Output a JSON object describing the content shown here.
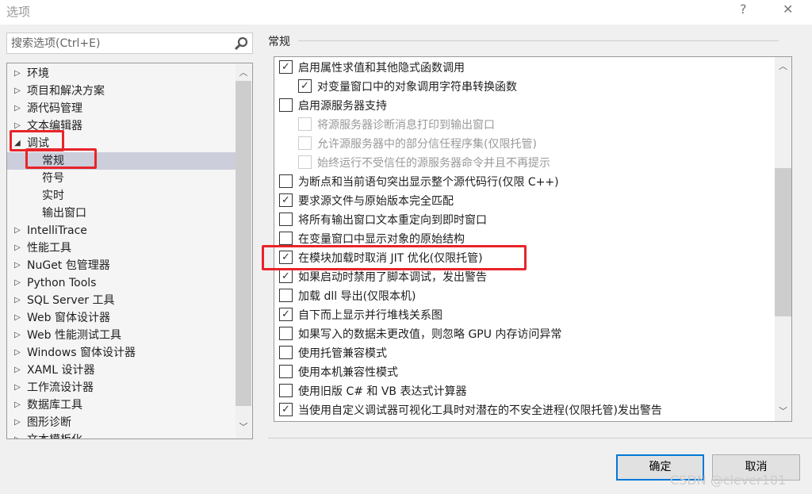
{
  "window": {
    "title": "选项",
    "help": "?",
    "close": "✕"
  },
  "search": {
    "placeholder": "搜索选项(Ctrl+E)"
  },
  "tree": {
    "items": [
      {
        "label": "环境",
        "level": 0,
        "expanded": false
      },
      {
        "label": "项目和解决方案",
        "level": 0,
        "expanded": false
      },
      {
        "label": "源代码管理",
        "level": 0,
        "expanded": false
      },
      {
        "label": "文本编辑器",
        "level": 0,
        "expanded": false
      },
      {
        "label": "调试",
        "level": 0,
        "expanded": true
      },
      {
        "label": "常规",
        "level": 1,
        "selected": true
      },
      {
        "label": "符号",
        "level": 1
      },
      {
        "label": "实时",
        "level": 1
      },
      {
        "label": "输出窗口",
        "level": 1
      },
      {
        "label": "IntelliTrace",
        "level": 0,
        "expanded": false
      },
      {
        "label": "性能工具",
        "level": 0,
        "expanded": false
      },
      {
        "label": "NuGet 包管理器",
        "level": 0,
        "expanded": false
      },
      {
        "label": "Python Tools",
        "level": 0,
        "expanded": false
      },
      {
        "label": "SQL Server 工具",
        "level": 0,
        "expanded": false
      },
      {
        "label": "Web 窗体设计器",
        "level": 0,
        "expanded": false
      },
      {
        "label": "Web 性能测试工具",
        "level": 0,
        "expanded": false
      },
      {
        "label": "Windows 窗体设计器",
        "level": 0,
        "expanded": false
      },
      {
        "label": "XAML 设计器",
        "level": 0,
        "expanded": false
      },
      {
        "label": "工作流设计器",
        "level": 0,
        "expanded": false
      },
      {
        "label": "数据库工具",
        "level": 0,
        "expanded": false
      },
      {
        "label": "图形诊断",
        "level": 0,
        "expanded": false
      },
      {
        "label": "文本模板化",
        "level": 0,
        "expanded": false
      }
    ]
  },
  "section": {
    "title": "常规"
  },
  "options": [
    {
      "label": "启用属性求值和其他隐式函数调用",
      "checked": true,
      "indent": 0,
      "enabled": true
    },
    {
      "label": "对变量窗口中的对象调用字符串转换函数",
      "checked": true,
      "indent": 1,
      "enabled": true
    },
    {
      "label": "启用源服务器支持",
      "checked": false,
      "indent": 0,
      "enabled": true
    },
    {
      "label": "将源服务器诊断消息打印到输出窗口",
      "checked": false,
      "indent": 1,
      "enabled": false
    },
    {
      "label": "允许源服务器中的部分信任程序集(仅限托管)",
      "checked": false,
      "indent": 1,
      "enabled": false
    },
    {
      "label": "始终运行不受信任的源服务器命令并且不再提示",
      "checked": false,
      "indent": 1,
      "enabled": false
    },
    {
      "label": "为断点和当前语句突出显示整个源代码行(仅限 C++)",
      "checked": false,
      "indent": 0,
      "enabled": true
    },
    {
      "label": "要求源文件与原始版本完全匹配",
      "checked": true,
      "indent": 0,
      "enabled": true
    },
    {
      "label": "将所有输出窗口文本重定向到即时窗口",
      "checked": false,
      "indent": 0,
      "enabled": true
    },
    {
      "label": "在变量窗口中显示对象的原始结构",
      "checked": false,
      "indent": 0,
      "enabled": true
    },
    {
      "label": "在模块加载时取消 JIT 优化(仅限托管)",
      "checked": true,
      "indent": 0,
      "enabled": true,
      "highlighted": true
    },
    {
      "label": "如果启动时禁用了脚本调试，发出警告",
      "checked": true,
      "indent": 0,
      "enabled": true
    },
    {
      "label": "加载 dll 导出(仅限本机)",
      "checked": false,
      "indent": 0,
      "enabled": true
    },
    {
      "label": "自下而上显示并行堆栈关系图",
      "checked": true,
      "indent": 0,
      "enabled": true
    },
    {
      "label": "如果写入的数据未更改值，则忽略 GPU 内存访问异常",
      "checked": false,
      "indent": 0,
      "enabled": true
    },
    {
      "label": "使用托管兼容模式",
      "checked": false,
      "indent": 0,
      "enabled": true
    },
    {
      "label": "使用本机兼容性模式",
      "checked": false,
      "indent": 0,
      "enabled": true
    },
    {
      "label": "使用旧版 C# 和 VB 表达式计算器",
      "checked": false,
      "indent": 0,
      "enabled": true
    },
    {
      "label": "当使用自定义调试器可视化工具时对潜在的不安全进程(仅限托管)发出警告",
      "checked": true,
      "indent": 0,
      "enabled": true
    }
  ],
  "buttons": {
    "ok": "确定",
    "cancel": "取消"
  },
  "watermark": "CSDN @clever101",
  "colors": {
    "highlight": "#e8242a",
    "accent": "#0078d7",
    "selection": "#cccedb"
  }
}
